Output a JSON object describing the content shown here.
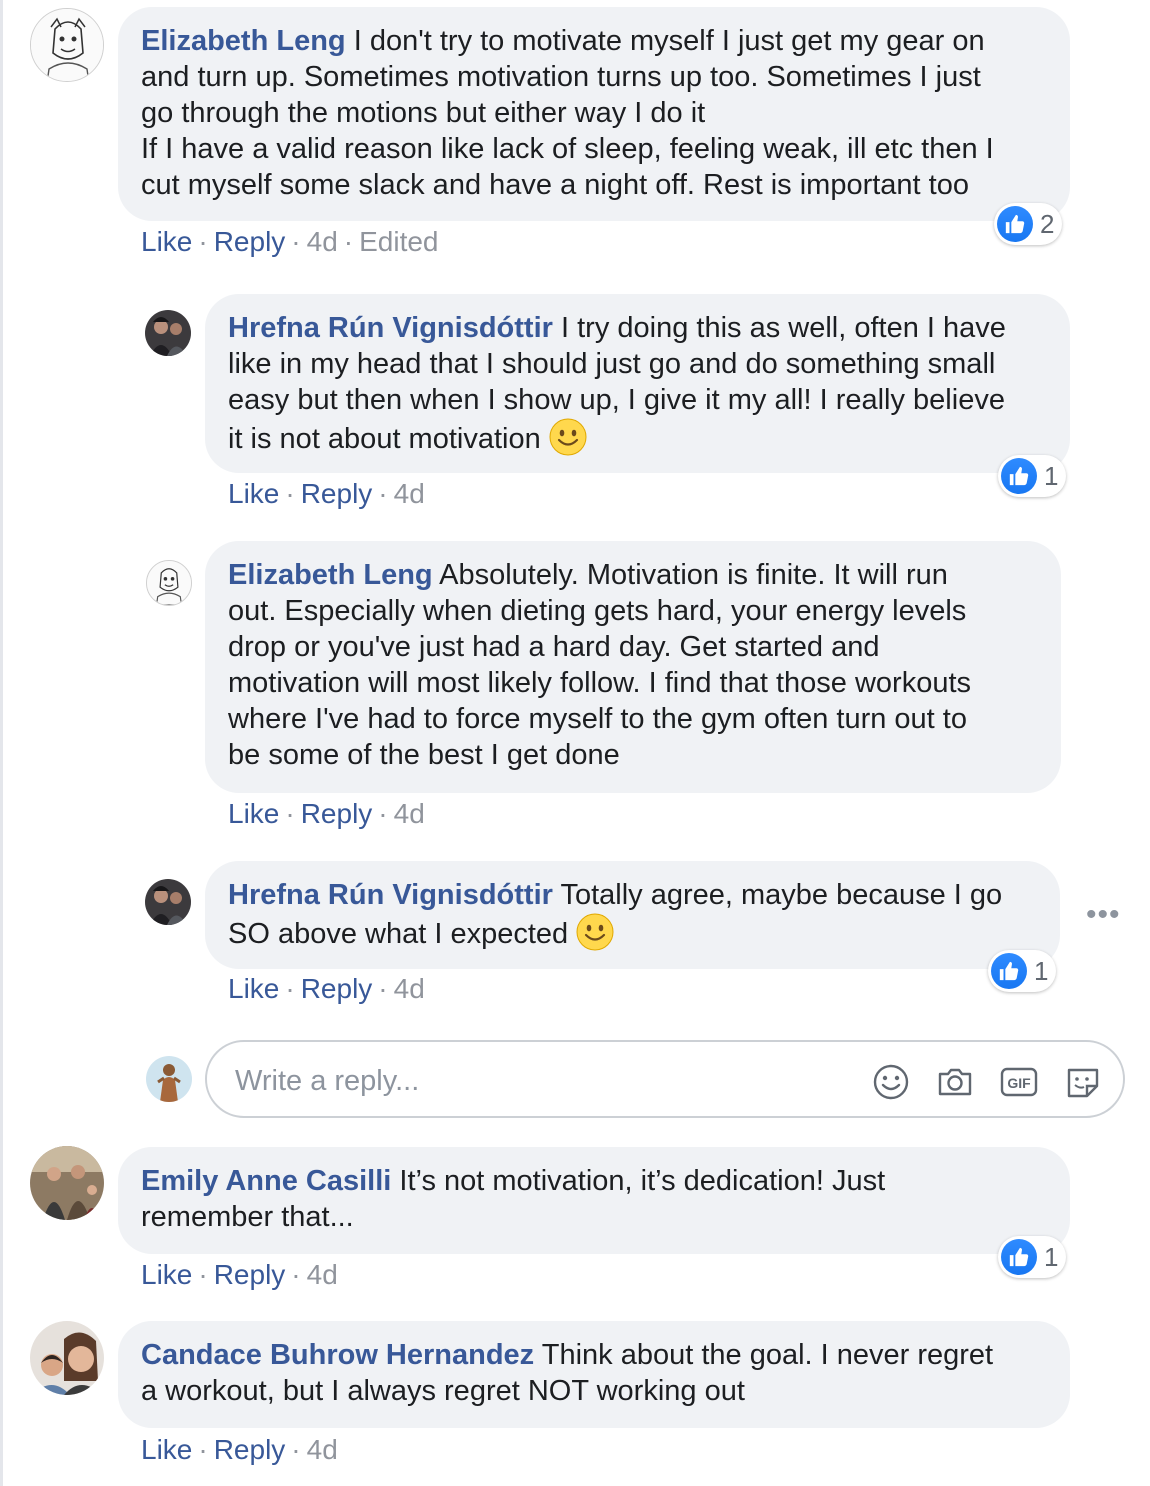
{
  "action_labels": {
    "like": "Like",
    "reply": "Reply",
    "separator": "·"
  },
  "comments": [
    {
      "author": "Elizabeth Leng",
      "lines": [
        "I don't try to motivate myself I just get my gear on",
        "and turn up. Sometimes motivation turns up too. Sometimes I just",
        "go through the motions but either way I do it",
        "If I have a valid reason like lack of sleep, feeling weak, ill etc then I",
        "cut myself some slack and have a night off. Rest is important too"
      ],
      "time": "4d",
      "edited": "Edited",
      "likes": "2",
      "replies": [
        {
          "author": "Hrefna Rún Vignisdóttir",
          "lines": [
            "I try doing this as well, often I have",
            "like in my head that I should just go and do something small",
            "easy but then when I show up, I give it my all! I really believe",
            "it is not about motivation"
          ],
          "emoji": "slightly-smiling-face",
          "time": "4d",
          "likes": "1"
        },
        {
          "author": "Elizabeth Leng",
          "lines": [
            "Absolutely. Motivation is finite. It will run",
            "out. Especially when dieting gets hard, your energy levels",
            "drop or you've just had a hard day. Get started and",
            "motivation will most likely follow. I find that those workouts",
            "where I've had to force myself to the gym often turn out to",
            "be some of the best I get done"
          ],
          "time": "4d"
        },
        {
          "author": "Hrefna Rún Vignisdóttir",
          "lines": [
            "Totally agree, maybe because I go",
            "SO above what I expected"
          ],
          "emoji": "slightly-smiling-face",
          "time": "4d",
          "likes": "1",
          "more_menu": "•••"
        }
      ],
      "reply_box": {
        "placeholder": "Write a reply...",
        "icons": [
          "emoji-icon",
          "camera-icon",
          "gif-icon",
          "sticker-icon"
        ]
      }
    },
    {
      "author": "Emily Anne Casilli",
      "lines": [
        "It’s not motivation, it’s dedication! Just",
        "remember that..."
      ],
      "time": "4d",
      "likes": "1"
    },
    {
      "author": "Candace Buhrow Hernandez",
      "lines": [
        "Think about the goal. I never regret",
        "a workout, but I always regret NOT working out"
      ],
      "time": "4d"
    }
  ],
  "colors": {
    "name": "#385898",
    "bubble": "#f0f2f5",
    "like_blue": "#1877f2",
    "meta": "#90949c"
  }
}
